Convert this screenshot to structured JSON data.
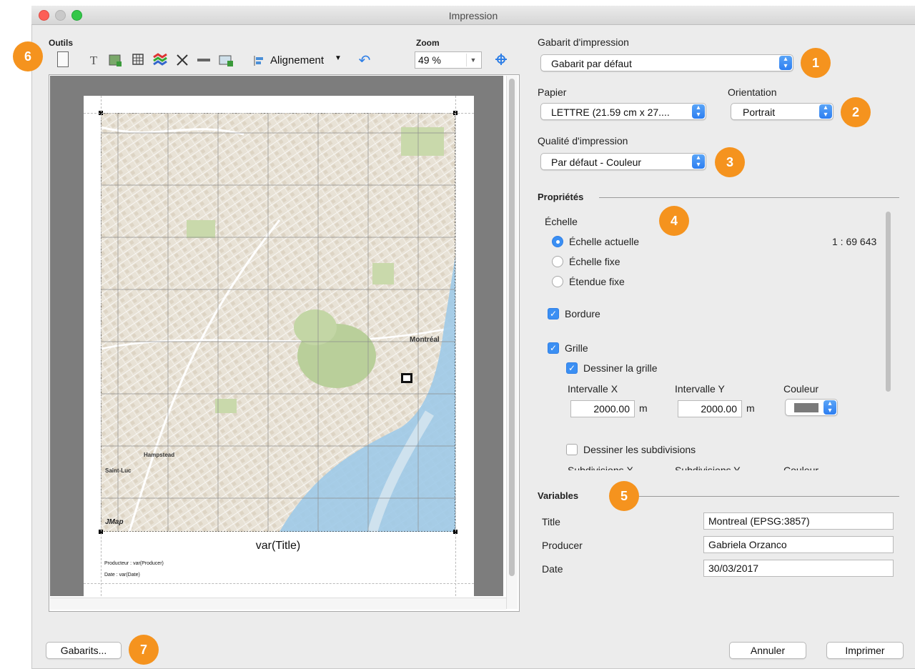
{
  "window": {
    "title": "Impression"
  },
  "tools": {
    "label": "Outils",
    "align_label": "Alignement",
    "zoom_label": "Zoom",
    "zoom_value": "49 %"
  },
  "preview": {
    "title_var": "var(Title)",
    "producer_line": "Producteur : var(Producer)",
    "date_line": "Date : var(Date)",
    "map_labels": {
      "montreal": "Montréal",
      "hampstead": "Hampstead",
      "saint_luc": "Saint-Luc",
      "logo": "JMap"
    }
  },
  "template": {
    "label": "Gabarit d'impression",
    "value": "Gabarit par défaut"
  },
  "paper": {
    "label": "Papier",
    "value": "LETTRE  (21.59 cm x 27...."
  },
  "orientation": {
    "label": "Orientation",
    "value": "Portrait"
  },
  "quality": {
    "label": "Qualité d'impression",
    "value": "Par défaut - Couleur"
  },
  "properties": {
    "header": "Propriétés",
    "scale_label": "Échelle",
    "scale_options": [
      "Échelle actuelle",
      "Échelle fixe",
      "Étendue fixe"
    ],
    "scale_value": "1 : 69 643",
    "border_label": "Bordure",
    "grid_label": "Grille",
    "draw_grid_label": "Dessiner la grille",
    "interval_x_label": "Intervalle X",
    "interval_y_label": "Intervalle Y",
    "color_label": "Couleur",
    "interval_x_value": "2000.00",
    "interval_y_value": "2000.00",
    "unit": "m",
    "grid_color": "#7a7a7a",
    "draw_subdiv_label": "Dessiner les subdivisions",
    "subdiv_x_label": "Subdivisions X",
    "subdiv_y_label": "Subdivisions Y",
    "subdiv_color_label": "Couleur"
  },
  "variables": {
    "header": "Variables",
    "rows": [
      {
        "name": "Title",
        "value": "Montreal (EPSG:3857)"
      },
      {
        "name": "Producer",
        "value": "Gabriela Orzanco"
      },
      {
        "name": "Date",
        "value": "30/03/2017"
      }
    ]
  },
  "buttons": {
    "templates": "Gabarits...",
    "cancel": "Annuler",
    "print": "Imprimer"
  },
  "badges": [
    "1",
    "2",
    "3",
    "4",
    "5",
    "6",
    "7"
  ],
  "colors": {
    "badge": "#f5931e",
    "accent": "#3b8ff3"
  }
}
